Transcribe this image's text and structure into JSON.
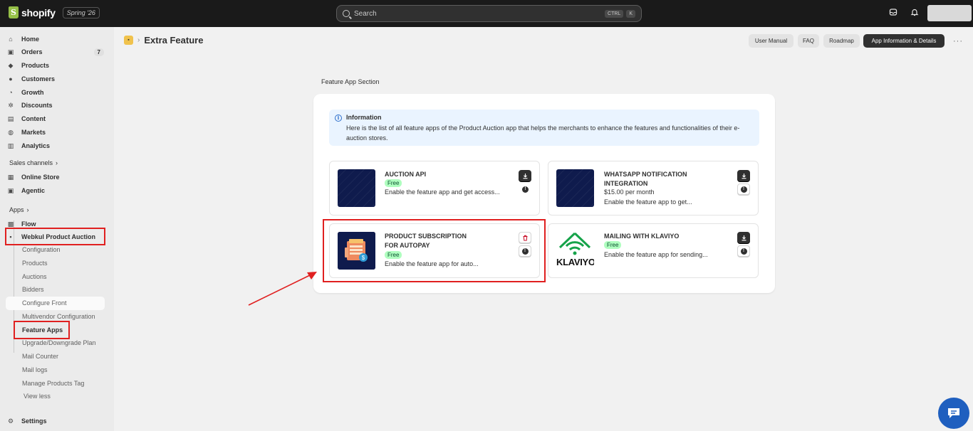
{
  "topbar": {
    "brand": "shopify",
    "edition": "Spring '26",
    "search_placeholder": "Search",
    "shortcut_1": "CTRL",
    "shortcut_2": "K"
  },
  "sidebar": {
    "main": [
      {
        "label": "Home",
        "icon": "home-icon"
      },
      {
        "label": "Orders",
        "icon": "inbox-icon",
        "count": "7"
      },
      {
        "label": "Products",
        "icon": "tag-icon"
      },
      {
        "label": "Customers",
        "icon": "person-icon"
      },
      {
        "label": "Growth",
        "icon": "gauge-icon"
      },
      {
        "label": "Discounts",
        "icon": "discount-icon"
      },
      {
        "label": "Content",
        "icon": "content-icon"
      },
      {
        "label": "Markets",
        "icon": "globe-icon"
      },
      {
        "label": "Analytics",
        "icon": "chart-icon"
      }
    ],
    "sales_channels_label": "Sales channels",
    "channels": [
      {
        "label": "Online Store",
        "icon": "store-icon"
      },
      {
        "label": "Agentic",
        "icon": "agentic-icon"
      }
    ],
    "apps_label": "Apps",
    "apps": [
      {
        "label": "Flow",
        "icon": "flow-icon"
      },
      {
        "label": "Webkul Product Auction",
        "icon": "app-icon"
      }
    ],
    "sub_items": [
      "Configuration",
      "Products",
      "Auctions",
      "Bidders",
      "Configure Front",
      "Multivendor Configuration",
      "Feature Apps",
      "Upgrade/Downgrade Plan",
      "Mail Counter",
      "Mail logs",
      "Manage Products Tag",
      "View less"
    ],
    "settings": "Settings"
  },
  "header": {
    "title": "Extra Feature",
    "buttons": [
      "User Manual",
      "FAQ",
      "Roadmap",
      "App Information & Details"
    ]
  },
  "main": {
    "section_title": "Feature App Section",
    "info_title": "Information",
    "info_text": "Here is the list of all feature apps of the Product Auction app that helps the merchants to enhance the features and functionalities of their e-auction stores.",
    "apps": [
      {
        "name": "AUCTION API",
        "badge": "Free",
        "desc": "Enable the feature app and get access..."
      },
      {
        "name": "WHATSAPP NOTIFICATION INTEGRATION",
        "price": "$15.00 per month",
        "desc": "Enable the feature app to get..."
      },
      {
        "name": "PRODUCT SUBSCRIPTION FOR AUTOPAY",
        "badge": "Free",
        "desc": "Enable the feature app for auto..."
      },
      {
        "name": "MAILING WITH KLAVIYO",
        "badge": "Free",
        "desc": "Enable the feature app for sending...",
        "logo_text": "KLAVIYO"
      }
    ]
  },
  "colors": {
    "highlight": "#e02020",
    "accent": "#1f5fbf",
    "free_badge": "#affebf"
  }
}
